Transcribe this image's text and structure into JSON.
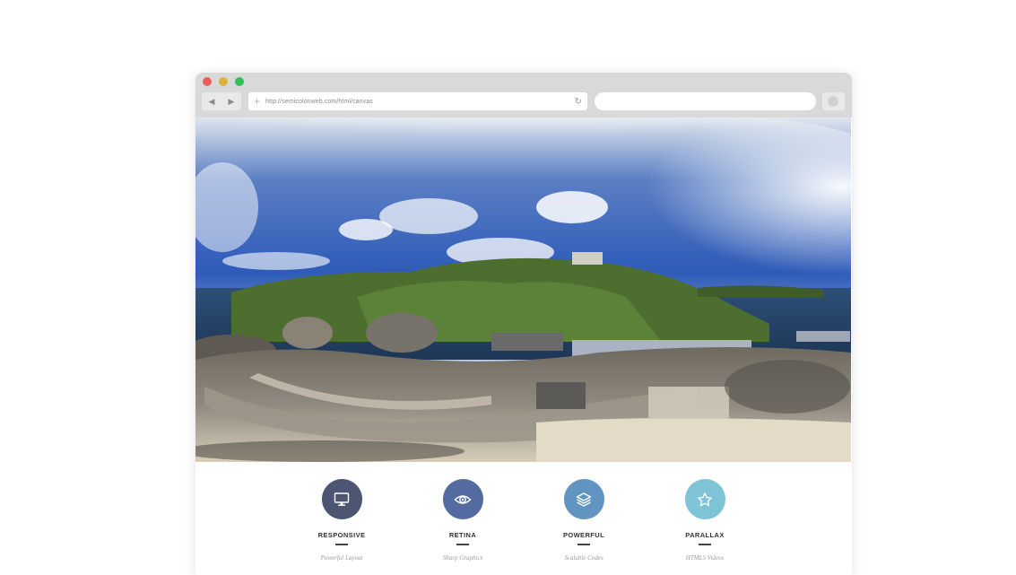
{
  "window": {
    "controls": [
      {
        "name": "close",
        "color": "#ec5f5a"
      },
      {
        "name": "minimize",
        "color": "#d9b33a"
      },
      {
        "name": "maximize",
        "color": "#2fc25b"
      }
    ]
  },
  "toolbar": {
    "back_icon": "◀",
    "forward_icon": "▶",
    "url": "http://semicolonweb.com/html/canvas",
    "new_tab_icon": "+",
    "reload_icon": "↻",
    "search_placeholder": ""
  },
  "features": [
    {
      "title": "RESPONSIVE",
      "subtitle": "Powerful Layout",
      "icon": "monitor-icon",
      "color": "#4c5571"
    },
    {
      "title": "RETINA",
      "subtitle": "Sharp Graphics",
      "icon": "eye-icon",
      "color": "#536ba0"
    },
    {
      "title": "POWERFUL",
      "subtitle": "Scalable Codes",
      "icon": "layers-icon",
      "color": "#6194c0"
    },
    {
      "title": "PARALLAX",
      "subtitle": "HTML5 Videos",
      "icon": "star-icon",
      "color": "#7ec3d6"
    }
  ]
}
